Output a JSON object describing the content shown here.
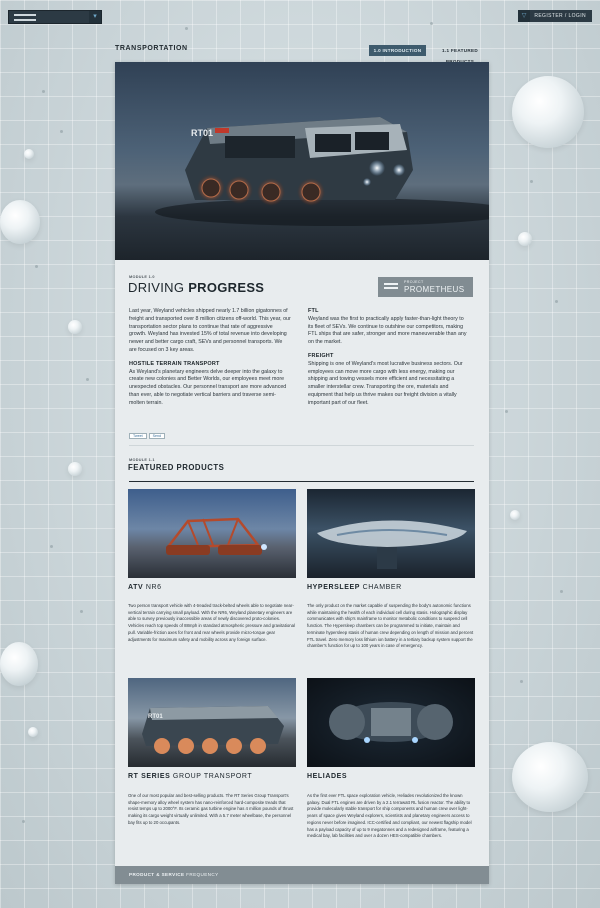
{
  "header": {
    "logo_icon": "weyland-logo-icon",
    "register_label": "REGISTER / LOGIN"
  },
  "page": {
    "title": "TRANSPORTATION",
    "tabs": [
      {
        "label": "1.0 INTRODUCTION",
        "active": true
      },
      {
        "label": "1.1 FEATURED PRODUCTS",
        "active": false
      }
    ]
  },
  "intro": {
    "module_label": "MODULE 1.0",
    "heading_light": "DRIVING ",
    "heading_bold": "PROGRESS",
    "badge_small": "PROJECT",
    "badge_large": "PROMETHEUS",
    "left_p1": "Last year, Weyland vehicles shipped nearly 1.7 billion gigatonnes of freight and transported over 8 million citizens off-world. This year, our transportation sector plans to continue that rate of aggressive growth.  Weyland has invested 15% of total revenue into developing newer and better cargo craft, SEVs and personnel transports. We are focused on 3 key areas.",
    "left_h": "HOSTILE TERRAIN TRANSPORT",
    "left_p2": "As Weyland's planetary engineers delve deeper into the galaxy to create new colonies and Better Worlds, our employees meet more unexpected obstacles. Our personnel transport are more advanced than ever, able to negotiate vertical barriers and traverse semi-molten terrain.",
    "right_h1": "FTL",
    "right_p1": "Weyland was the first to practically apply faster-than-light theory to its fleet of SEVs.  We continue to outshine our competitors, making FTL ships that are safer, stronger and more maneuverable than any on the market.",
    "right_h2": "FREIGHT",
    "right_p2": "Shipping is one of Weyland's most lucrative business sectors. Our employees can move more cargo with less energy, making our shipping and towing vessels more efficient and necessitating a smaller interstellar crew.  Transporting the ore, materials and equipment that help us thrive makes our freight division a vitally important part of our fleet.",
    "share_tweet": "Tweet",
    "share_send": "Send"
  },
  "featured": {
    "module_label": "MODULE 1.1",
    "heading": "FEATURED PRODUCTS",
    "products": [
      {
        "name_bold": "ATV",
        "name_light": " NR6",
        "desc": "Two person transport vehicle with 4-treaded track-belted wheels able to negotiate near-vertical terrain carrying small payload.  With the NR6, Weyland planetary engineers are able to survey previously inaccessible areas of newly discovered proto-colonies. Vehicles reach top speeds of 88mph in standard atmospheric pressure and gravitational pull. Variable-friction axes for front and rear wheels provide micro-torque gear adjustments for maximum safety and mobility across any foreign surface."
      },
      {
        "name_bold": "HYPERSLEEP",
        "name_light": " CHAMBER",
        "desc": "The only product on the market capable of suspending the body's autonomic functions while maintaining the health of each individual cell during stasis. Holographic display communicates with ship's mainframe to monitor metabolic conditions to suspend cell function.  The Hypersleep chambers can be programmed to initiate, maintain and terminate hypersleep stasis of human crew depending on length of mission and percent FTL travel. Zero memory loss lithium ion battery in a tertiary backup system support the chamber's function for up to 100 years in case of emergency."
      },
      {
        "name_bold": "RT SERIES",
        "name_light": " GROUP TRANSPORT",
        "desc": "One of our most popular and best-selling products.  The RT Series Group Transport's shape-memory alloy wheel system has nano-reinforced hard-composite treads that resist temps up to 2000°F.  Its ceramic gas turbine engine has 4 million pounds of thrust making its cargo weight virtually unlimited.  With a 5.7 meter wheelbase, the personnel bay fits up to 20 occupants."
      },
      {
        "name_bold": "HELIADES",
        "name_light": "",
        "desc": "As the first ever FTL space exploration vehicle, Heliades revolutionized the known galaxy. Dual FTL engines are driven by a 2.1 terrawatt RL fusion reactor. The ability to provide molecularly stable transport for ship components and human crew over light-years of space gives Weyland explorers, scientists and planetary engineers access to regions never before imagined.  ICC-certified and compliant, our newest flagship model has a payload capacity of up to 9 megatonnes and a redesigned airframe, featuring a medical bay, lab facilities and over a dozen HES-compatible chambers."
      }
    ]
  },
  "footer": {
    "bold": "PRODUCT & SERVICE",
    "light": " FREQUENCY"
  }
}
